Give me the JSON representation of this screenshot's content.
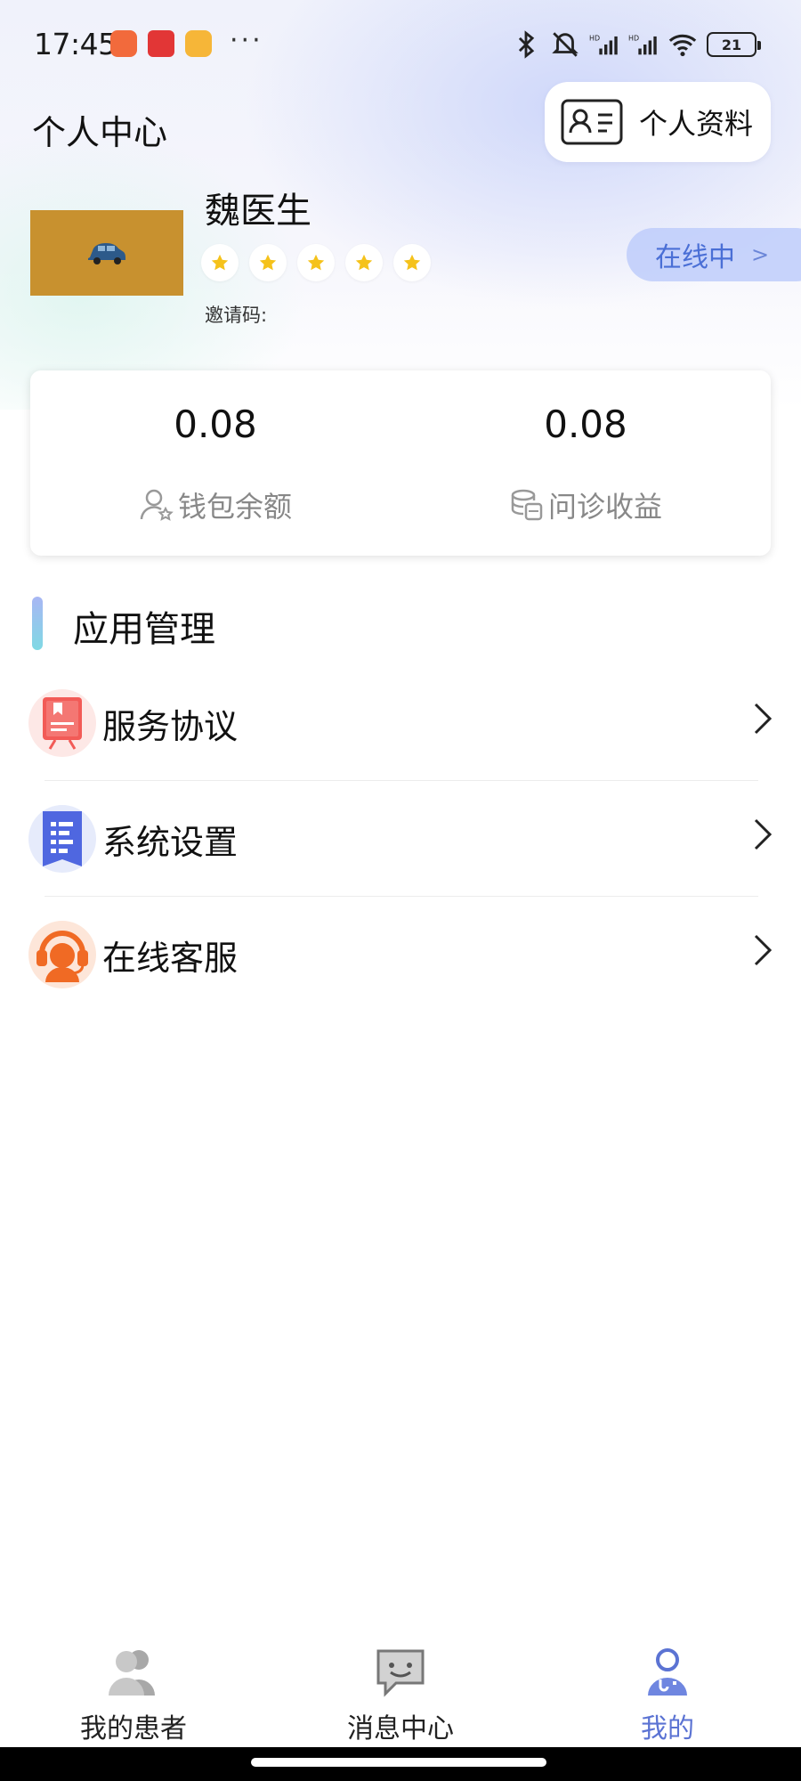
{
  "status_bar": {
    "time": "17:45",
    "battery": "21"
  },
  "header": {
    "title": "个人中心",
    "profile_button": "个人资料"
  },
  "user": {
    "name": "魏医生",
    "rating_stars": 5,
    "invite_label": "邀请码:",
    "status": "在线中"
  },
  "balances": [
    {
      "value": "0.08",
      "label": "钱包余额",
      "icon": "user-star-icon"
    },
    {
      "value": "0.08",
      "label": "问诊收益",
      "icon": "coins-icon"
    }
  ],
  "section": {
    "title": "应用管理"
  },
  "menu": [
    {
      "label": "服务协议",
      "icon": "agreement-icon"
    },
    {
      "label": "系统设置",
      "icon": "settings-doc-icon"
    },
    {
      "label": "在线客服",
      "icon": "headset-agent-icon"
    }
  ],
  "tabs": [
    {
      "label": "我的患者",
      "icon": "patients-icon",
      "active": false
    },
    {
      "label": "消息中心",
      "icon": "message-icon",
      "active": false
    },
    {
      "label": "我的",
      "icon": "doctor-profile-icon",
      "active": true
    }
  ],
  "colors": {
    "accent": "#5b73d3",
    "status_pill_bg": "#bccdfa",
    "avatar_bg": "#c8912f"
  }
}
